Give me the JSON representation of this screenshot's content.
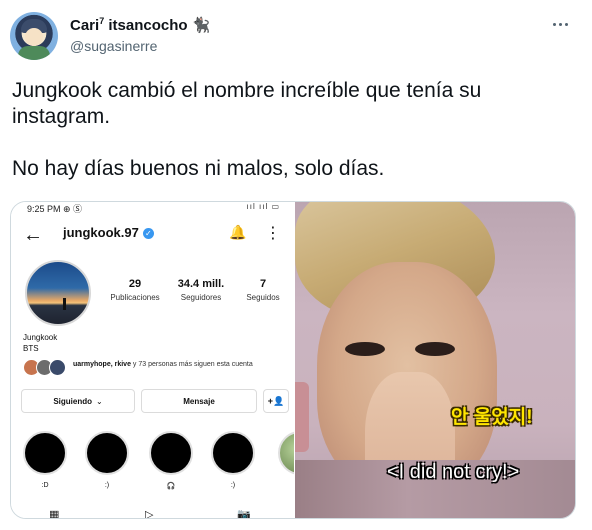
{
  "tweet": {
    "display_name": "Cari",
    "display_name_sup": "7",
    "display_name_rest": " itsancocho",
    "cat_emoji": "🐈‍⬛",
    "handle": "@sugasinerre",
    "text_line1": "Jungkook cambió el nombre increíble que tenía su instagram.",
    "text_line2": "No hay días buenos ni malos, solo días."
  },
  "instagram": {
    "status_time": "9:25 PM ⊕ Ⓢ",
    "status_right": "ııl ııl ▭",
    "back_arrow": "←",
    "username": "jungkook.97",
    "verified_mark": "✓",
    "bell_icon": "🔔",
    "kebab_icon": "⋮",
    "stats": [
      {
        "num": "29",
        "label": "Publicaciones"
      },
      {
        "num": "34.4 mill.",
        "label": "Seguidores"
      },
      {
        "num": "7",
        "label": "Seguidos"
      }
    ],
    "profile_name": "Jungkook",
    "bio": "BTS",
    "followed_by_bold": "uarmyhope, rkive",
    "followed_by_rest": " y 73 personas más siguen esta cuenta",
    "follow_button": "Siguiendo",
    "follow_chevron": "⌄",
    "message_button": "Mensaje",
    "add_person_icon": "+👤",
    "highlights": [
      ":D",
      ":)",
      "🎧",
      ":)"
    ],
    "nav": {
      "grid": "▦",
      "reels": "▷",
      "tagged": "📷"
    }
  },
  "meme": {
    "caption_ko": "안 울었지!",
    "caption_en": "<I did not cry!>"
  },
  "more_icon": "more-horizontal"
}
